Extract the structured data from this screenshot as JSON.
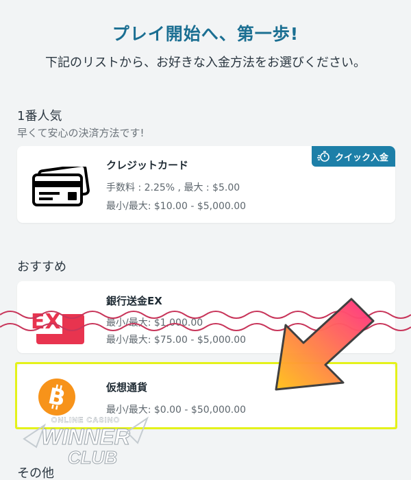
{
  "header": {
    "title": "プレイ開始へ、第一歩!",
    "subtitle": "下記のリストから、お好きな入金方法をお選びください。"
  },
  "popular": {
    "label": "1番人気",
    "description": "早くて安心の決済方法です!",
    "card": {
      "name": "クレジットカード",
      "fee": "手数料 : 2.25% , 最大 : $5.00",
      "limits": "最小/最大: $10.00 - $5,000.00",
      "badge": "クイック入金",
      "icon": "credit-card-icon"
    }
  },
  "recommended": {
    "label": "おすすめ",
    "cards": [
      {
        "name": "銀行送金EX",
        "line1": "最小/最大: $1,000.00",
        "line2": "最小/最大: $75.00 - $5,000.00",
        "logo_text": "EX",
        "icon": "bank-transfer-ex-logo"
      },
      {
        "name": "仮想通貨",
        "limits": "最小/最大: $0.00 - $50,000.00",
        "icon": "bitcoin-icon"
      }
    ]
  },
  "other": {
    "label": "その他"
  },
  "watermark": {
    "line1": "ONLINE CASINO",
    "line2": "WINNER",
    "line3": "CLUB"
  },
  "colors": {
    "title": "#1b6f92",
    "badge": "#1d7fa8",
    "highlight": "#e4f21a",
    "bitcoin": "#f7931a",
    "wavy_line": "#c8355a",
    "arrow_start": "#ffc21a",
    "arrow_end": "#ff2d87"
  }
}
